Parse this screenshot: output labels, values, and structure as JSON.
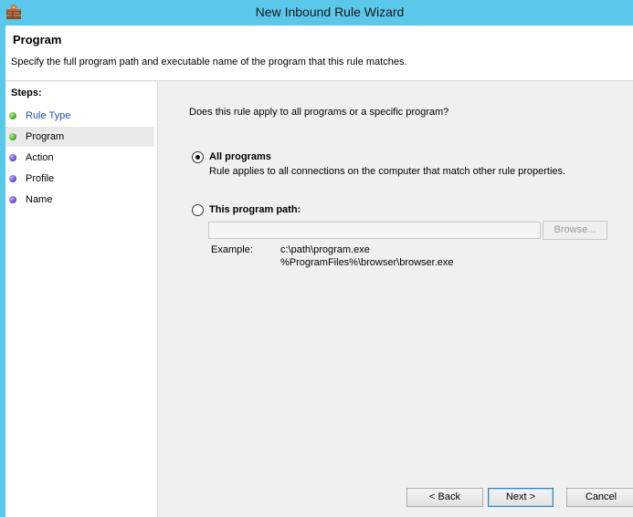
{
  "window": {
    "title": "New Inbound Rule Wizard"
  },
  "header": {
    "title": "Program",
    "description": "Specify the full program path and executable name of the program that this rule matches."
  },
  "steps": {
    "title": "Steps:",
    "items": [
      {
        "label": "Rule Type",
        "status": "complete"
      },
      {
        "label": "Program",
        "status": "current"
      },
      {
        "label": "Action",
        "status": "pending"
      },
      {
        "label": "Profile",
        "status": "pending"
      },
      {
        "label": "Name",
        "status": "pending"
      }
    ]
  },
  "content": {
    "question": "Does this rule apply to all programs or a specific program?",
    "options": [
      {
        "label": "All programs",
        "description": "Rule applies to all connections on the computer that match other rule properties.",
        "selected": true
      },
      {
        "label": "This program path:",
        "selected": false
      }
    ],
    "path_input": {
      "value": ""
    },
    "browse_label": "Browse...",
    "example": {
      "label": "Example:",
      "lines": [
        "c:\\path\\program.exe",
        "%ProgramFiles%\\browser\\browser.exe"
      ]
    }
  },
  "footer": {
    "back_label": "< Back",
    "next_label": "Next >",
    "cancel_label": "Cancel"
  },
  "colors": {
    "title_bar": "#5ac8ea",
    "step_complete": "#4cae2a",
    "step_pending": "#6a48d6",
    "link_text": "#1e55b3"
  }
}
